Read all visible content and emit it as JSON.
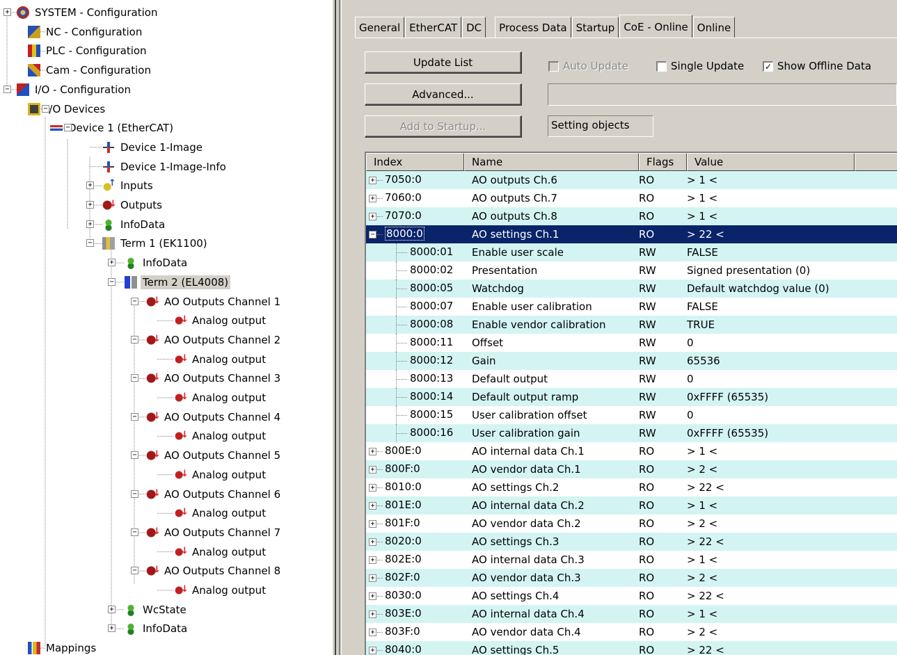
{
  "tree": {
    "items": [
      {
        "label": "SYSTEM - Configuration",
        "icon": "system-config-icon",
        "toggle": "+"
      },
      {
        "label": "NC - Configuration",
        "icon": "nc-config-icon"
      },
      {
        "label": "PLC - Configuration",
        "icon": "plc-config-icon"
      },
      {
        "label": "Cam - Configuration",
        "icon": "cam-config-icon"
      },
      {
        "label": "I/O - Configuration",
        "icon": "io-config-icon",
        "toggle": "−"
      },
      {
        "label": "I/O Devices",
        "icon": "io-devices-icon",
        "toggle": "−"
      },
      {
        "label": "Device 1 (EtherCAT)",
        "icon": "ethercat-device-icon",
        "toggle": "−"
      },
      {
        "label": "Device 1-Image",
        "icon": "process-image-icon"
      },
      {
        "label": "Device 1-Image-Info",
        "icon": "process-image-icon"
      },
      {
        "label": "Inputs",
        "icon": "inputs-icon",
        "toggle": "+"
      },
      {
        "label": "Outputs",
        "icon": "outputs-icon",
        "toggle": "+"
      },
      {
        "label": "InfoData",
        "icon": "infodata-icon",
        "toggle": "+"
      },
      {
        "label": "Term 1 (EK1100)",
        "icon": "terminal-icon",
        "toggle": "−"
      },
      {
        "label": "InfoData",
        "icon": "infodata-icon",
        "toggle": "+"
      },
      {
        "label": "Term 2 (EL4008)",
        "icon": "terminal-el4008-icon",
        "toggle": "−",
        "selected": true
      },
      {
        "label": "AO Outputs Channel 1",
        "icon": "ao-outputs-icon",
        "toggle": "−"
      },
      {
        "label": "Analog output",
        "icon": "analog-output-icon"
      },
      {
        "label": "AO Outputs Channel 2",
        "icon": "ao-outputs-icon",
        "toggle": "−"
      },
      {
        "label": "Analog output",
        "icon": "analog-output-icon"
      },
      {
        "label": "AO Outputs Channel 3",
        "icon": "ao-outputs-icon",
        "toggle": "−"
      },
      {
        "label": "Analog output",
        "icon": "analog-output-icon"
      },
      {
        "label": "AO Outputs Channel 4",
        "icon": "ao-outputs-icon",
        "toggle": "−"
      },
      {
        "label": "Analog output",
        "icon": "analog-output-icon"
      },
      {
        "label": "AO Outputs Channel 5",
        "icon": "ao-outputs-icon",
        "toggle": "−"
      },
      {
        "label": "Analog output",
        "icon": "analog-output-icon"
      },
      {
        "label": "AO Outputs Channel 6",
        "icon": "ao-outputs-icon",
        "toggle": "−"
      },
      {
        "label": "Analog output",
        "icon": "analog-output-icon"
      },
      {
        "label": "AO Outputs Channel 7",
        "icon": "ao-outputs-icon",
        "toggle": "−"
      },
      {
        "label": "Analog output",
        "icon": "analog-output-icon"
      },
      {
        "label": "AO Outputs Channel 8",
        "icon": "ao-outputs-icon",
        "toggle": "−"
      },
      {
        "label": "Analog output",
        "icon": "analog-output-icon"
      },
      {
        "label": "WcState",
        "icon": "wcstate-icon",
        "toggle": "+"
      },
      {
        "label": "InfoData",
        "icon": "infodata-icon",
        "toggle": "+"
      },
      {
        "label": "Mappings",
        "icon": "mappings-icon"
      }
    ]
  },
  "tabs": [
    "General",
    "EtherCAT",
    "DC",
    "Process Data",
    "Startup",
    "CoE - Online",
    "Online"
  ],
  "active_tab": "CoE - Online",
  "buttons": {
    "update_list": "Update List",
    "advanced": "Advanced...",
    "add_to_startup": "Add to Startup..."
  },
  "checkboxes": {
    "auto_update": {
      "label": "Auto Update",
      "checked": false,
      "enabled": false
    },
    "single_update": {
      "label": "Single Update",
      "checked": false
    },
    "show_offline": {
      "label": "Show Offline Data",
      "checked": true
    }
  },
  "status_field": {
    "value": "",
    "setting_objects": "Setting objects"
  },
  "list": {
    "columns": [
      "Index",
      "Name",
      "Flags",
      "Value"
    ],
    "rows": [
      {
        "index": "7050:0",
        "name": "AO outputs Ch.6",
        "flags": "RO",
        "value": "> 1 <",
        "toggle": "+"
      },
      {
        "index": "7060:0",
        "name": "AO outputs Ch.7",
        "flags": "RO",
        "value": "> 1 <",
        "toggle": "+"
      },
      {
        "index": "7070:0",
        "name": "AO outputs Ch.8",
        "flags": "RO",
        "value": "> 1 <",
        "toggle": "+"
      },
      {
        "index": "8000:0",
        "name": "AO settings Ch.1",
        "flags": "RO",
        "value": "> 22 <",
        "toggle": "−",
        "selected": true
      },
      {
        "index": "8000:01",
        "name": "Enable user scale",
        "flags": "RW",
        "value": "FALSE",
        "sub": true
      },
      {
        "index": "8000:02",
        "name": "Presentation",
        "flags": "RW",
        "value": "Signed presentation (0)",
        "sub": true
      },
      {
        "index": "8000:05",
        "name": "Watchdog",
        "flags": "RW",
        "value": "Default watchdog value (0)",
        "sub": true
      },
      {
        "index": "8000:07",
        "name": "Enable user calibration",
        "flags": "RW",
        "value": "FALSE",
        "sub": true
      },
      {
        "index": "8000:08",
        "name": "Enable vendor calibration",
        "flags": "RW",
        "value": "TRUE",
        "sub": true
      },
      {
        "index": "8000:11",
        "name": "Offset",
        "flags": "RW",
        "value": "0",
        "sub": true
      },
      {
        "index": "8000:12",
        "name": "Gain",
        "flags": "RW",
        "value": "65536",
        "sub": true
      },
      {
        "index": "8000:13",
        "name": "Default output",
        "flags": "RW",
        "value": "0",
        "sub": true
      },
      {
        "index": "8000:14",
        "name": "Default output ramp",
        "flags": "RW",
        "value": "0xFFFF (65535)",
        "sub": true
      },
      {
        "index": "8000:15",
        "name": "User calibration offset",
        "flags": "RW",
        "value": "0",
        "sub": true
      },
      {
        "index": "8000:16",
        "name": "User calibration gain",
        "flags": "RW",
        "value": "0xFFFF (65535)",
        "sub": true
      },
      {
        "index": "800E:0",
        "name": "AO internal data Ch.1",
        "flags": "RO",
        "value": "> 1 <",
        "toggle": "+"
      },
      {
        "index": "800F:0",
        "name": "AO vendor data Ch.1",
        "flags": "RO",
        "value": "> 2 <",
        "toggle": "+"
      },
      {
        "index": "8010:0",
        "name": "AO settings Ch.2",
        "flags": "RO",
        "value": "> 22 <",
        "toggle": "+"
      },
      {
        "index": "801E:0",
        "name": "AO internal data Ch.2",
        "flags": "RO",
        "value": "> 1 <",
        "toggle": "+"
      },
      {
        "index": "801F:0",
        "name": "AO vendor data Ch.2",
        "flags": "RO",
        "value": "> 2 <",
        "toggle": "+"
      },
      {
        "index": "8020:0",
        "name": "AO settings Ch.3",
        "flags": "RO",
        "value": "> 22 <",
        "toggle": "+"
      },
      {
        "index": "802E:0",
        "name": "AO internal data Ch.3",
        "flags": "RO",
        "value": "> 1 <",
        "toggle": "+"
      },
      {
        "index": "802F:0",
        "name": "AO vendor data Ch.3",
        "flags": "RO",
        "value": "> 2 <",
        "toggle": "+"
      },
      {
        "index": "8030:0",
        "name": "AO settings Ch.4",
        "flags": "RO",
        "value": "> 22 <",
        "toggle": "+"
      },
      {
        "index": "803E:0",
        "name": "AO internal data Ch.4",
        "flags": "RO",
        "value": "> 1 <",
        "toggle": "+"
      },
      {
        "index": "803F:0",
        "name": "AO vendor data Ch.4",
        "flags": "RO",
        "value": "> 2 <",
        "toggle": "+"
      },
      {
        "index": "8040:0",
        "name": "AO settings Ch.5",
        "flags": "RO",
        "value": "> 22 <",
        "toggle": "+"
      }
    ]
  },
  "colors": {
    "row_alt": "#d4f4f4",
    "selection": "#0a246a",
    "window_face": "#d4d0c8"
  }
}
